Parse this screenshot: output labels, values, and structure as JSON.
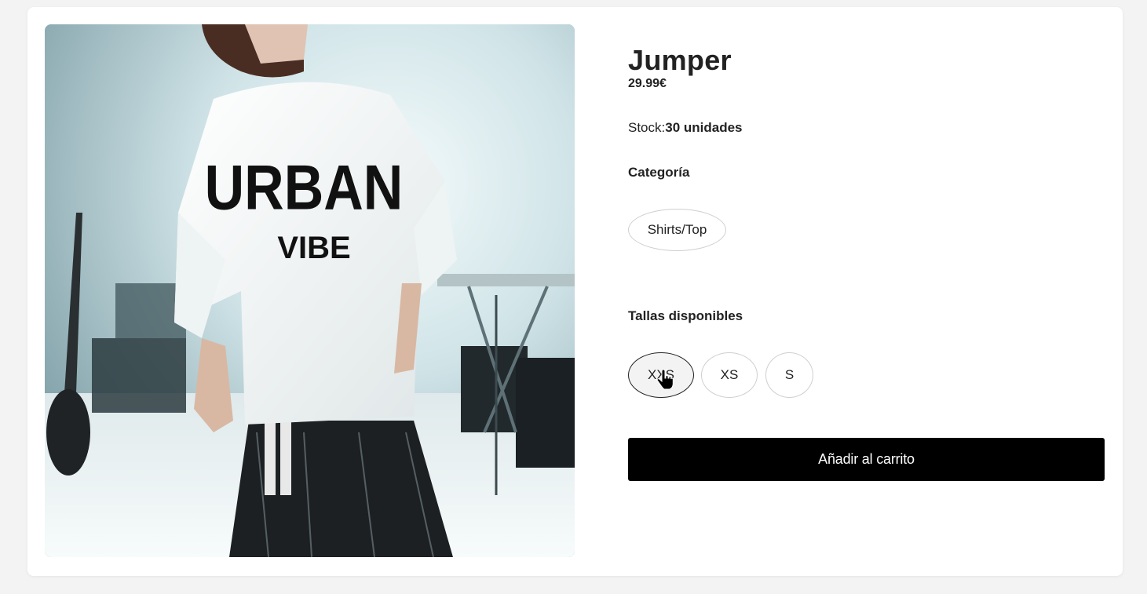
{
  "product": {
    "name": "Jumper",
    "price": "29.99€",
    "stock_label": "Stock:",
    "stock_value": "30 unidades",
    "shirt_text_line1": "URBAN",
    "shirt_text_line2": "VIBE",
    "image_icon": "product-photo"
  },
  "category": {
    "heading": "Categoría",
    "value": "Shirts/Top"
  },
  "sizes": {
    "heading": "Tallas disponibles",
    "options": [
      "XXS",
      "XS",
      "S"
    ],
    "selected": "XXS"
  },
  "actions": {
    "add_to_cart": "Añadir al carrito"
  },
  "colors": {
    "page_bg": "#f3f3f3",
    "card_bg": "#ffffff",
    "button_bg": "#000000",
    "button_text": "#ffffff"
  }
}
